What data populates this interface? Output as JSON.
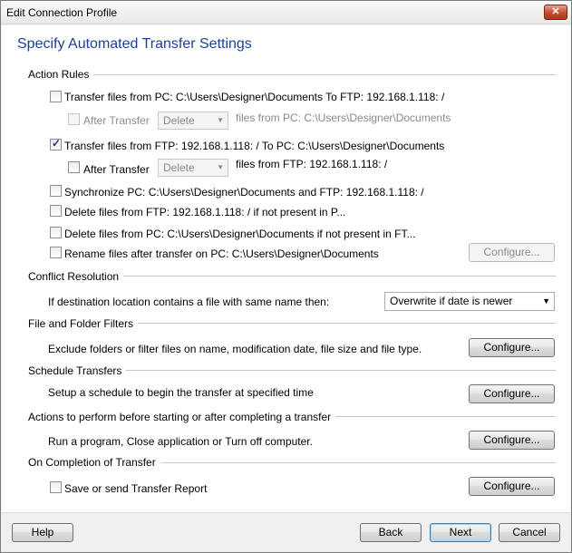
{
  "window": {
    "title": "Edit Connection Profile",
    "close_label": "✕"
  },
  "heading": "Specify Automated Transfer Settings",
  "action_rules": {
    "title": "Action Rules",
    "rule1": {
      "label": "Transfer files from PC: C:\\Users\\Designer\\Documents  To  FTP: 192.168.1.118: /",
      "checked": false
    },
    "rule1_after": {
      "label": "After Transfer",
      "select_value": "Delete",
      "suffix": "files from PC: C:\\Users\\Designer\\Documents"
    },
    "rule2": {
      "label": "Transfer files from FTP: 192.168.1.118: /  To  PC: C:\\Users\\Designer\\Documents",
      "checked": true
    },
    "rule2_after": {
      "label": "After Transfer",
      "select_value": "Delete",
      "suffix": "files from FTP: 192.168.1.118: /"
    },
    "rule3": {
      "label": "Synchronize PC: C:\\Users\\Designer\\Documents and FTP: 192.168.1.118: /"
    },
    "rule4": {
      "label": "Delete files from FTP: 192.168.1.118: / if not present in P..."
    },
    "rule5": {
      "label": "Delete files from PC: C:\\Users\\Designer\\Documents if not present in FT..."
    },
    "rule6": {
      "label": "Rename files after transfer on PC: C:\\Users\\Designer\\Documents",
      "button": "Configure..."
    }
  },
  "conflict": {
    "title": "Conflict Resolution",
    "label": "If destination location contains a file with same name then:",
    "select_value": "Overwrite if date is newer"
  },
  "filters": {
    "title": "File and Folder Filters",
    "label": "Exclude folders or filter files on name, modification date, file size and file type.",
    "button": "Configure..."
  },
  "schedule": {
    "title": "Schedule Transfers",
    "label": "Setup a schedule to begin the transfer at specified time",
    "button": "Configure..."
  },
  "actions": {
    "title": "Actions to perform before starting or after completing a transfer",
    "label": "Run a program, Close application or Turn off computer.",
    "button": "Configure..."
  },
  "completion": {
    "title": "On Completion of Transfer",
    "label": "Save or send Transfer Report",
    "button": "Configure..."
  },
  "footer": {
    "help": "Help",
    "back": "Back",
    "next": "Next",
    "cancel": "Cancel"
  }
}
